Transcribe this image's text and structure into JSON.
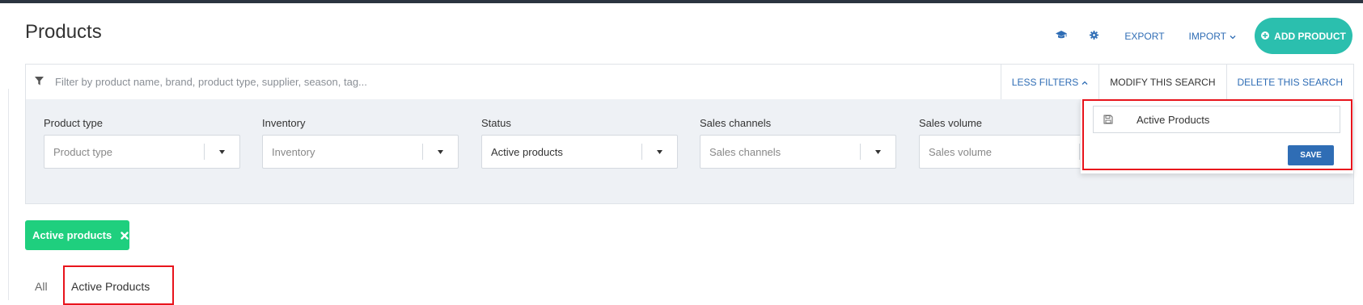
{
  "page": {
    "title": "Products"
  },
  "toolbar": {
    "tutorial_icon": "graduation-cap-icon",
    "settings_icon": "gear-icon",
    "export_label": "EXPORT",
    "import_label": "IMPORT",
    "add_product_label": "ADD PRODUCT",
    "accent_color": "#2bbfae",
    "link_color": "#2f6db5"
  },
  "search": {
    "placeholder": "Filter by product name, brand, product type, supplier, season, tag...",
    "less_filters_label": "LESS FILTERS",
    "modify_label": "MODIFY THIS SEARCH",
    "delete_label": "DELETE THIS SEARCH"
  },
  "filters": [
    {
      "label": "Product type",
      "value": "Product type",
      "is_placeholder": true
    },
    {
      "label": "Inventory",
      "value": "Inventory",
      "is_placeholder": true
    },
    {
      "label": "Status",
      "value": "Active products",
      "is_placeholder": false
    },
    {
      "label": "Sales channels",
      "value": "Sales channels",
      "is_placeholder": true
    },
    {
      "label": "Sales volume",
      "value": "Sales volume",
      "is_placeholder": true
    }
  ],
  "save_search": {
    "name_value": "Active Products",
    "save_label": "SAVE"
  },
  "active_filter_chip": {
    "label": "Active products",
    "color": "#1fcf7e"
  },
  "tabs": [
    {
      "label": "All"
    },
    {
      "label": "Active Products"
    }
  ],
  "highlight_color": "#e8141c"
}
